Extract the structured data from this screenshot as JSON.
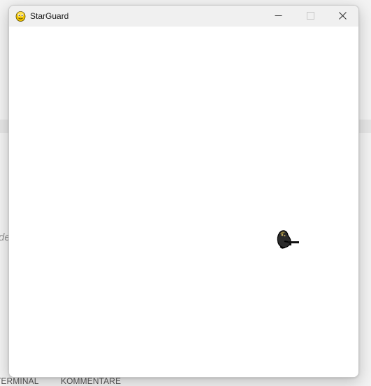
{
  "window": {
    "title": "StarGuard",
    "app_icon": "pygame-snake-icon",
    "controls": [
      "minimize-icon",
      "maximize-icon",
      "close-icon"
    ]
  },
  "game": {
    "background_color": "#ffffff",
    "sprite": "soldier-with-gun-sprite"
  },
  "background_app": {
    "text_fragment": "de",
    "panel_tabs": [
      "TERMINAL",
      "KOMMENTARE"
    ]
  }
}
